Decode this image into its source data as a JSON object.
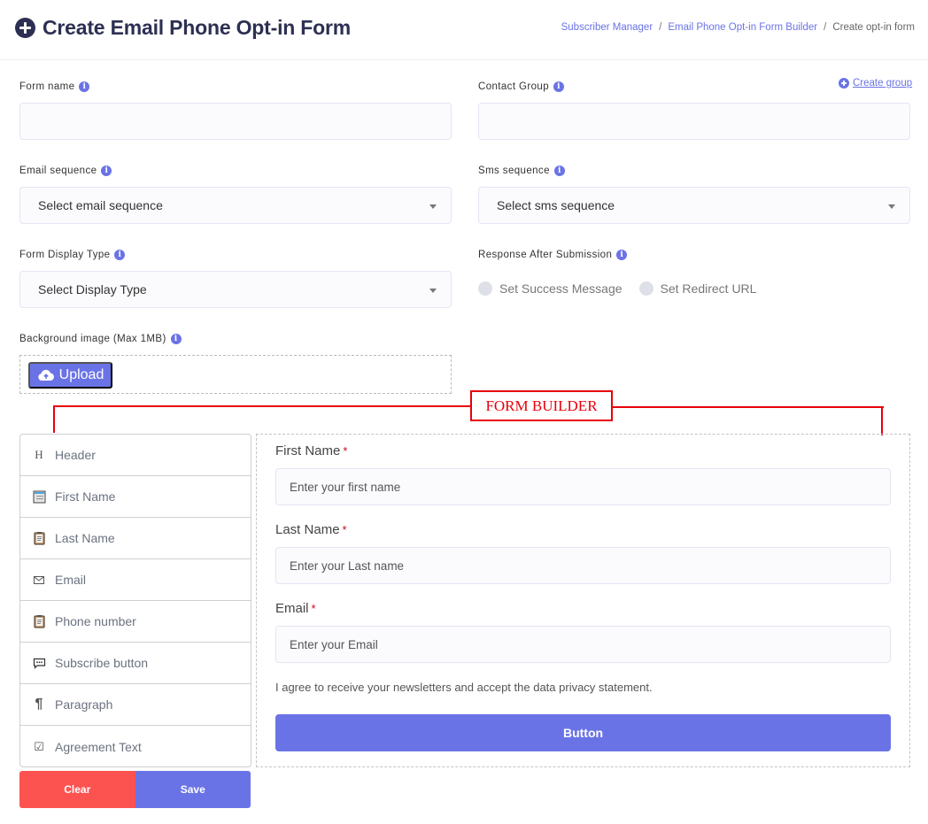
{
  "header": {
    "title": "Create Email Phone Opt-in Form",
    "title_icon": "plus-circle-icon",
    "breadcrumb": [
      {
        "label": "Subscriber Manager",
        "link": true
      },
      {
        "label": "Email Phone Opt-in Form Builder",
        "link": true
      },
      {
        "label": "Create opt-in form",
        "link": false
      }
    ],
    "breadcrumb_separator": "/"
  },
  "form": {
    "form_name": {
      "label": "Form name",
      "value": "",
      "info_icon": "info-icon"
    },
    "contact_group": {
      "label": "Contact Group",
      "value": "",
      "info_icon": "info-icon",
      "create_link": "Create group"
    },
    "email_sequence": {
      "label": "Email sequence",
      "selected": "Select email sequence"
    },
    "sms_sequence": {
      "label": "Sms sequence",
      "selected": "Select sms sequence"
    },
    "display_type": {
      "label": "Form Display Type",
      "selected": "Select Display Type"
    },
    "response": {
      "label": "Response After Submission",
      "options": [
        {
          "label": "Set Success Message",
          "checked": false
        },
        {
          "label": "Set Redirect URL",
          "checked": false
        }
      ]
    },
    "background_image": {
      "label": "Background image (Max 1MB)",
      "upload_label": "Upload",
      "upload_icon": "cloud-upload-icon"
    }
  },
  "annotation": {
    "label": "FORM BUILDER",
    "color": "#e8000b"
  },
  "palette": {
    "items": [
      {
        "label": "Header",
        "icon": "heading-icon",
        "glyph": "H"
      },
      {
        "label": "First Name",
        "icon": "text-field-icon",
        "glyph": "▤"
      },
      {
        "label": "Last Name",
        "icon": "clipboard-icon",
        "glyph": "📋"
      },
      {
        "label": "Email",
        "icon": "envelope-icon",
        "glyph": "✉"
      },
      {
        "label": "Phone number",
        "icon": "clipboard-icon",
        "glyph": "📋"
      },
      {
        "label": "Subscribe button",
        "icon": "speech-bubble-icon",
        "glyph": "💬"
      },
      {
        "label": "Paragraph",
        "icon": "pilcrow-icon",
        "glyph": "¶"
      },
      {
        "label": "Agreement Text",
        "icon": "checkbox-icon",
        "glyph": "☑"
      }
    ],
    "clear_label": "Clear",
    "save_label": "Save"
  },
  "preview": {
    "fields": [
      {
        "label": "First Name",
        "required": "*",
        "placeholder": "Enter your first name"
      },
      {
        "label": "Last Name",
        "required": "*",
        "placeholder": "Enter your Last name"
      },
      {
        "label": "Email",
        "required": "*",
        "placeholder": "Enter your Email"
      }
    ],
    "agreement": "I agree to receive your newsletters and accept the data privacy statement.",
    "button_label": "Button"
  },
  "colors": {
    "accent": "#6a73e6",
    "danger": "#fd5350",
    "title": "#2d3052"
  }
}
